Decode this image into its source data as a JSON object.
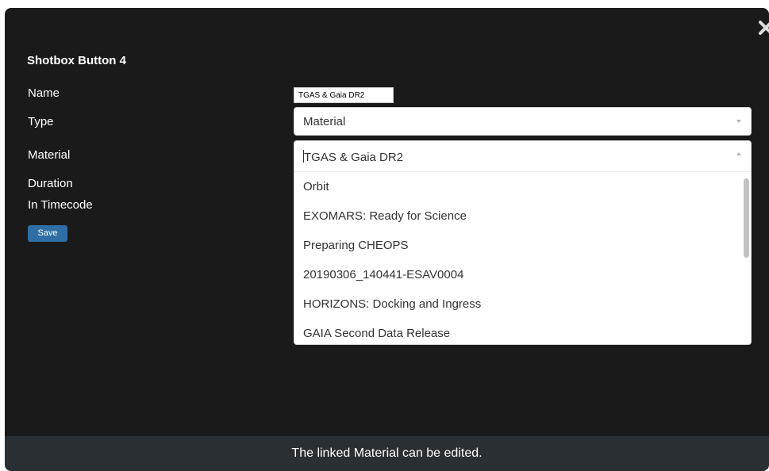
{
  "dialog": {
    "title": "Shotbox Button 4",
    "close_icon": "close-x-icon"
  },
  "form": {
    "labels": {
      "name": "Name",
      "type": "Type",
      "material": "Material",
      "duration": "Duration",
      "in_timecode": "In Timecode"
    },
    "name_value": "TGAS & Gaia DR2",
    "type_value": "Material",
    "material_value": "TGAS & Gaia DR2",
    "save_label": "Save"
  },
  "material_dropdown": {
    "expanded": true,
    "options": [
      "Orbit",
      "EXOMARS: Ready for Science",
      "Preparing CHEOPS",
      "20190306_140441-ESAV0004",
      "HORIZONS: Docking and Ingress",
      "GAIA Second Data Release"
    ]
  },
  "caption": "The linked Material can be edited.",
  "colors": {
    "background": "#1a1a1a",
    "save_button": "#2f6ea5",
    "caption_bar": "#2a2f33"
  }
}
